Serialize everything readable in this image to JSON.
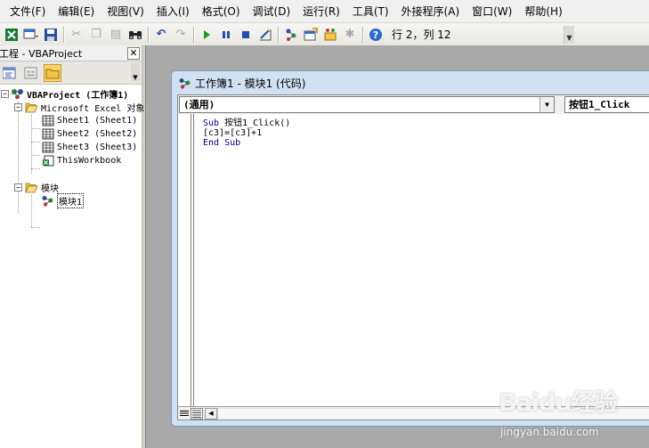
{
  "menubar": {
    "items": [
      "文件(F)",
      "编辑(E)",
      "视图(V)",
      "插入(I)",
      "格式(O)",
      "调试(D)",
      "运行(R)",
      "工具(T)",
      "外接程序(A)",
      "窗口(W)",
      "帮助(H)"
    ]
  },
  "toolbar": {
    "position_status": "行 2，列 12"
  },
  "project_pane": {
    "title": "工程 - VBAProject",
    "tree": {
      "project": "VBAProject (工作簿1)",
      "excel_objects_folder": "Microsoft Excel 对象",
      "sheet1": "Sheet1 (Sheet1)",
      "sheet2": "Sheet2 (Sheet2)",
      "sheet3": "Sheet3 (Sheet3)",
      "this_workbook": "ThisWorkbook",
      "modules_folder": "模块",
      "module1": "模块1"
    }
  },
  "code_window": {
    "title": "工作簿1 - 模块1 (代码)",
    "object_combo": "(通用)",
    "procedure_combo": "按钮1_Click",
    "code": {
      "line1_kw": "Sub",
      "line1_rest": " 按钮1_Click()",
      "line2": "[c3]=[c3]+1",
      "line3": "End Sub"
    }
  },
  "watermark": {
    "logo": "Baidu经验",
    "url": "jingyan.baidu.com"
  },
  "colors": {
    "menubar_bg": "#f0f0f0",
    "mdi_bg": "#a9a9a9",
    "code_window_frame": "#cfe1f3",
    "keyword": "#00008b"
  }
}
